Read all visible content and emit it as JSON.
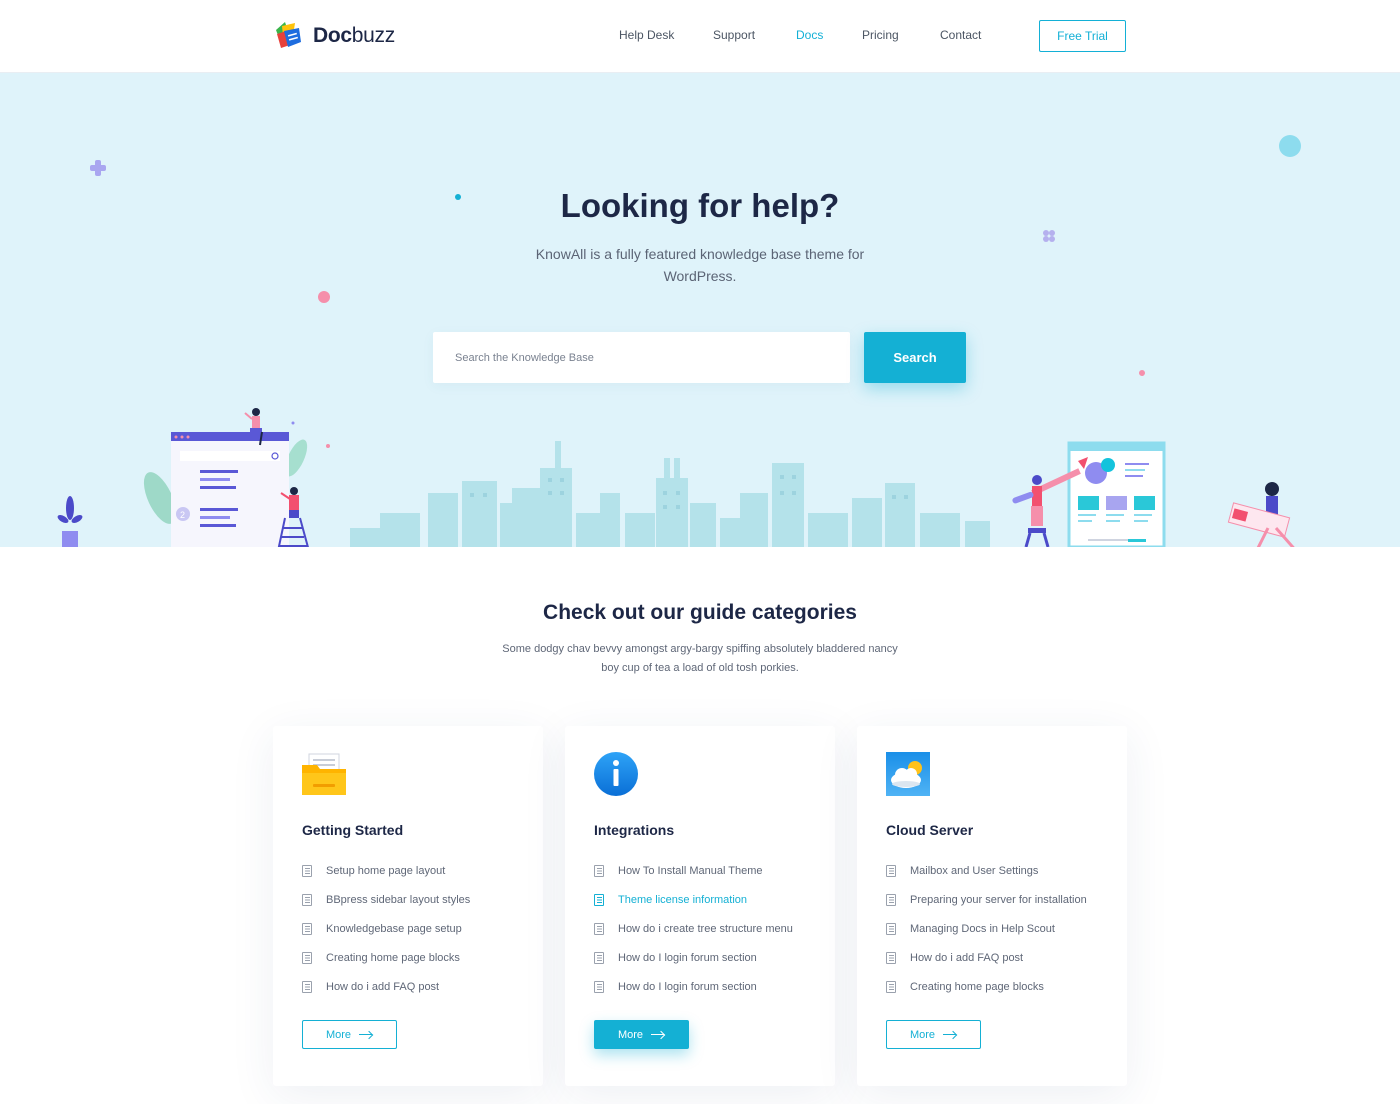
{
  "brand": {
    "name_bold": "Doc",
    "name_thin": "buzz"
  },
  "nav": {
    "items": [
      {
        "label": "Help Desk",
        "active": false
      },
      {
        "label": "Support",
        "active": false
      },
      {
        "label": "Docs",
        "active": true
      },
      {
        "label": "Pricing",
        "active": false
      },
      {
        "label": "Contact",
        "active": false
      }
    ],
    "cta_label": "Free Trial"
  },
  "hero": {
    "title": "Looking for help?",
    "subtitle": "KnowAll is a fully featured knowledge base theme for WordPress.",
    "search_placeholder": "Search the Knowledge Base",
    "search_button": "Search"
  },
  "guides": {
    "title": "Check out our guide categories",
    "subtitle": "Some dodgy chav bevvy amongst argy-bargy spiffing absolutely bladdered nancy boy cup of tea a load of old tosh porkies."
  },
  "cards": [
    {
      "title": "Getting Started",
      "icon": "folder-icon",
      "items": [
        {
          "label": "Setup home page layout",
          "highlight": false
        },
        {
          "label": "BBpress sidebar layout styles",
          "highlight": false
        },
        {
          "label": "Knowledgebase page setup",
          "highlight": false
        },
        {
          "label": "Creating home page blocks",
          "highlight": false
        },
        {
          "label": "How do i add FAQ post",
          "highlight": false
        }
      ],
      "more_label": "More"
    },
    {
      "title": "Integrations",
      "icon": "info-icon",
      "items": [
        {
          "label": "How To Install Manual Theme",
          "highlight": false
        },
        {
          "label": "Theme license information",
          "highlight": true
        },
        {
          "label": "How do i create tree structure menu",
          "highlight": false
        },
        {
          "label": "How do I login forum section",
          "highlight": false
        },
        {
          "label": "How do I login forum section",
          "highlight": false
        }
      ],
      "more_label": "More"
    },
    {
      "title": "Cloud Server",
      "icon": "cloud-sun-icon",
      "items": [
        {
          "label": "Mailbox and User Settings",
          "highlight": false
        },
        {
          "label": "Preparing your server for installation",
          "highlight": false
        },
        {
          "label": "Managing Docs in Help Scout",
          "highlight": false
        },
        {
          "label": "How do i add FAQ post",
          "highlight": false
        },
        {
          "label": "Creating home page blocks",
          "highlight": false
        }
      ],
      "more_label": "More"
    }
  ],
  "colors": {
    "accent": "#14b0d4",
    "hero_bg": "#dff3fa",
    "heading": "#1d2746"
  }
}
